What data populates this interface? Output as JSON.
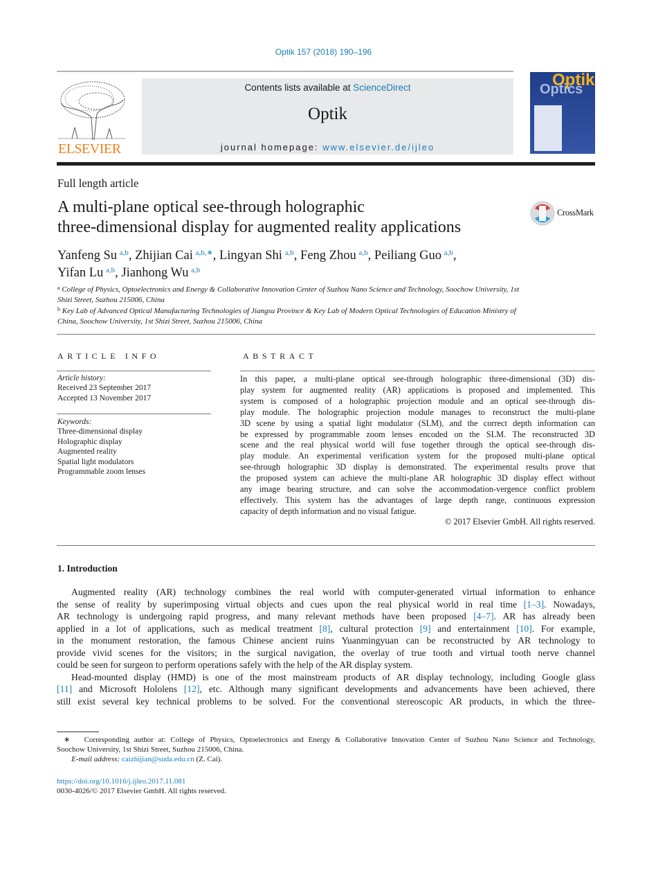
{
  "header": {
    "journal_ref": "Optik 157 (2018) 190–196",
    "contents_prefix": "Contents lists available at ",
    "contents_link": "ScienceDirect",
    "journal_name": "Optik",
    "homepage_prefix": "journal homepage: ",
    "homepage_link": "www.elsevier.de/ijleo",
    "publisher_logo": "ELSEVIER",
    "cover_title": "Optik",
    "cover_subtitle": "Optics"
  },
  "article": {
    "type": "Full length article",
    "title_lines": [
      "A multi-plane optical see-through holographic",
      "three-dimensional display for augmented reality applications"
    ],
    "crossmark": "CrossMark",
    "authors": [
      {
        "name": "Yanfeng Su",
        "sup": "a,b",
        "sep": ", "
      },
      {
        "name": "Zhijian Cai",
        "sup": "a,b,∗",
        "sep": ", "
      },
      {
        "name": "Lingyan Shi",
        "sup": "a,b",
        "sep": ", "
      },
      {
        "name": "Feng Zhou",
        "sup": "a,b",
        "sep": ", "
      },
      {
        "name": "Peiliang Guo",
        "sup": "a,b",
        "sep": ","
      },
      {
        "name": "Yifan Lu",
        "sup": "a,b",
        "sep": ", "
      },
      {
        "name": "Jianhong Wu",
        "sup": "a,b",
        "sep": ""
      }
    ],
    "affiliations": [
      {
        "mark": "a",
        "text": "College of Physics, Optoelectronics and Energy & Collaborative Innovation Center of Suzhou Nano Science and Technology, Soochow University, 1st Shizi Street, Suzhou 215006, China"
      },
      {
        "mark": "b",
        "text": "Key Lab of Advanced Optical Manufacturing Technologies of Jiangsu Province & Key Lab of Modern Optical Technologies of Education Ministry of China, Soochow University, 1st Shizi Street, Suzhou 215006, China"
      }
    ]
  },
  "article_info": {
    "heading": "ARTICLE INFO",
    "history_label": "Article history:",
    "received": "Received 23 September 2017",
    "accepted": "Accepted 13 November 2017",
    "keywords_label": "Keywords:",
    "keywords": [
      "Three-dimensional display",
      "Holographic display",
      "Augmented reality",
      "Spatial light modulators",
      "Programmable zoom lenses"
    ]
  },
  "abstract": {
    "heading": "ABSTRACT",
    "lines": [
      "In this paper, a multi-plane optical see-through holographic three-dimensional (3D) dis-",
      "play system for augmented reality (AR) applications is proposed and implemented. This",
      "system is composed of a holographic projection module and an optical see-through dis-",
      "play module. The holographic projection module manages to reconstruct the multi-plane",
      "3D scene by using a spatial light modulator (SLM), and the correct depth information can",
      "be expressed by programmable zoom lenses encoded on the SLM. The reconstructed 3D",
      "scene and the real physical world will fuse together through the optical see-through dis-",
      "play module. An experimental verification system for the proposed multi-plane optical",
      "see-through holographic 3D display is demonstrated. The experimental results prove that",
      "the proposed system can achieve the multi-plane AR holographic 3D display effect without",
      "any image bearing structure, and can solve the accommodation-vergence conflict problem",
      "effectively. This system has the advantages of large depth range, continuous expression",
      "capacity of depth information and no visual fatigue."
    ],
    "copyright": "© 2017 Elsevier GmbH. All rights reserved."
  },
  "introduction": {
    "heading": "1.  Introduction",
    "lines": [
      [
        {
          "t": "Augmented reality (AR) technology combines the real world with computer-generated virtual information to enhance"
        }
      ],
      [
        {
          "t": "the sense of reality by superimposing virtual objects and cues upon the real physical world in real time "
        },
        {
          "t": "[1–3]",
          "link": true
        },
        {
          "t": ". Nowadays,"
        }
      ],
      [
        {
          "t": "AR technology is undergoing rapid progress, and many relevant methods have been proposed "
        },
        {
          "t": "[4–7]",
          "link": true
        },
        {
          "t": ". AR has already been"
        }
      ],
      [
        {
          "t": "applied in a lot of applications, such as medical treatment "
        },
        {
          "t": "[8]",
          "link": true
        },
        {
          "t": ", cultural protection "
        },
        {
          "t": "[9]",
          "link": true
        },
        {
          "t": " and entertainment "
        },
        {
          "t": "[10]",
          "link": true
        },
        {
          "t": ". For example,"
        }
      ],
      [
        {
          "t": "in the monument restoration, the famous Chinese ancient ruins Yuanmingyuan can be reconstructed by AR technology to"
        }
      ],
      [
        {
          "t": "provide vivid scenes for the visitors; in the surgical navigation, the overlay of true tooth and virtual tooth nerve channel"
        }
      ],
      [
        {
          "t": "could be seen for surgeon to perform operations safely with the help of the AR display system."
        }
      ],
      [
        {
          "t": "Head-mounted display (HMD) is one of the most mainstream products of AR display technology, including Google glass"
        }
      ],
      [
        {
          "t": "[11]",
          "link": true
        },
        {
          "t": " and Microsoft Hololens "
        },
        {
          "t": "[12]",
          "link": true
        },
        {
          "t": ", etc. Although many significant developments and advancements have been achieved, there"
        }
      ],
      [
        {
          "t": "still exist several key technical problems to be solved. For the conventional stereoscopic AR products, in which the three-"
        }
      ]
    ]
  },
  "footnotes": {
    "star": "∗",
    "corresponding_line1": "Corresponding author at: College of Physics, Optoelectronics and Energy & Collaborative Innovation Center of Suzhou Nano Science and Technology,",
    "corresponding_line2": "Soochow University, 1st Shizi Street, Suzhou 215006, China.",
    "email_label": "E-mail address: ",
    "email": "caizhijian@suda.edu.cn",
    "email_suffix": " (Z. Cai).",
    "doi": "https://doi.org/10.1016/j.ijleo.2017.11.081",
    "issn": "0030-4026/© 2017 Elsevier GmbH. All rights reserved."
  },
  "colors": {
    "link": "#1a7db8",
    "elsevier_orange": "#f07f1c",
    "header_box": "#e8e9eb"
  }
}
